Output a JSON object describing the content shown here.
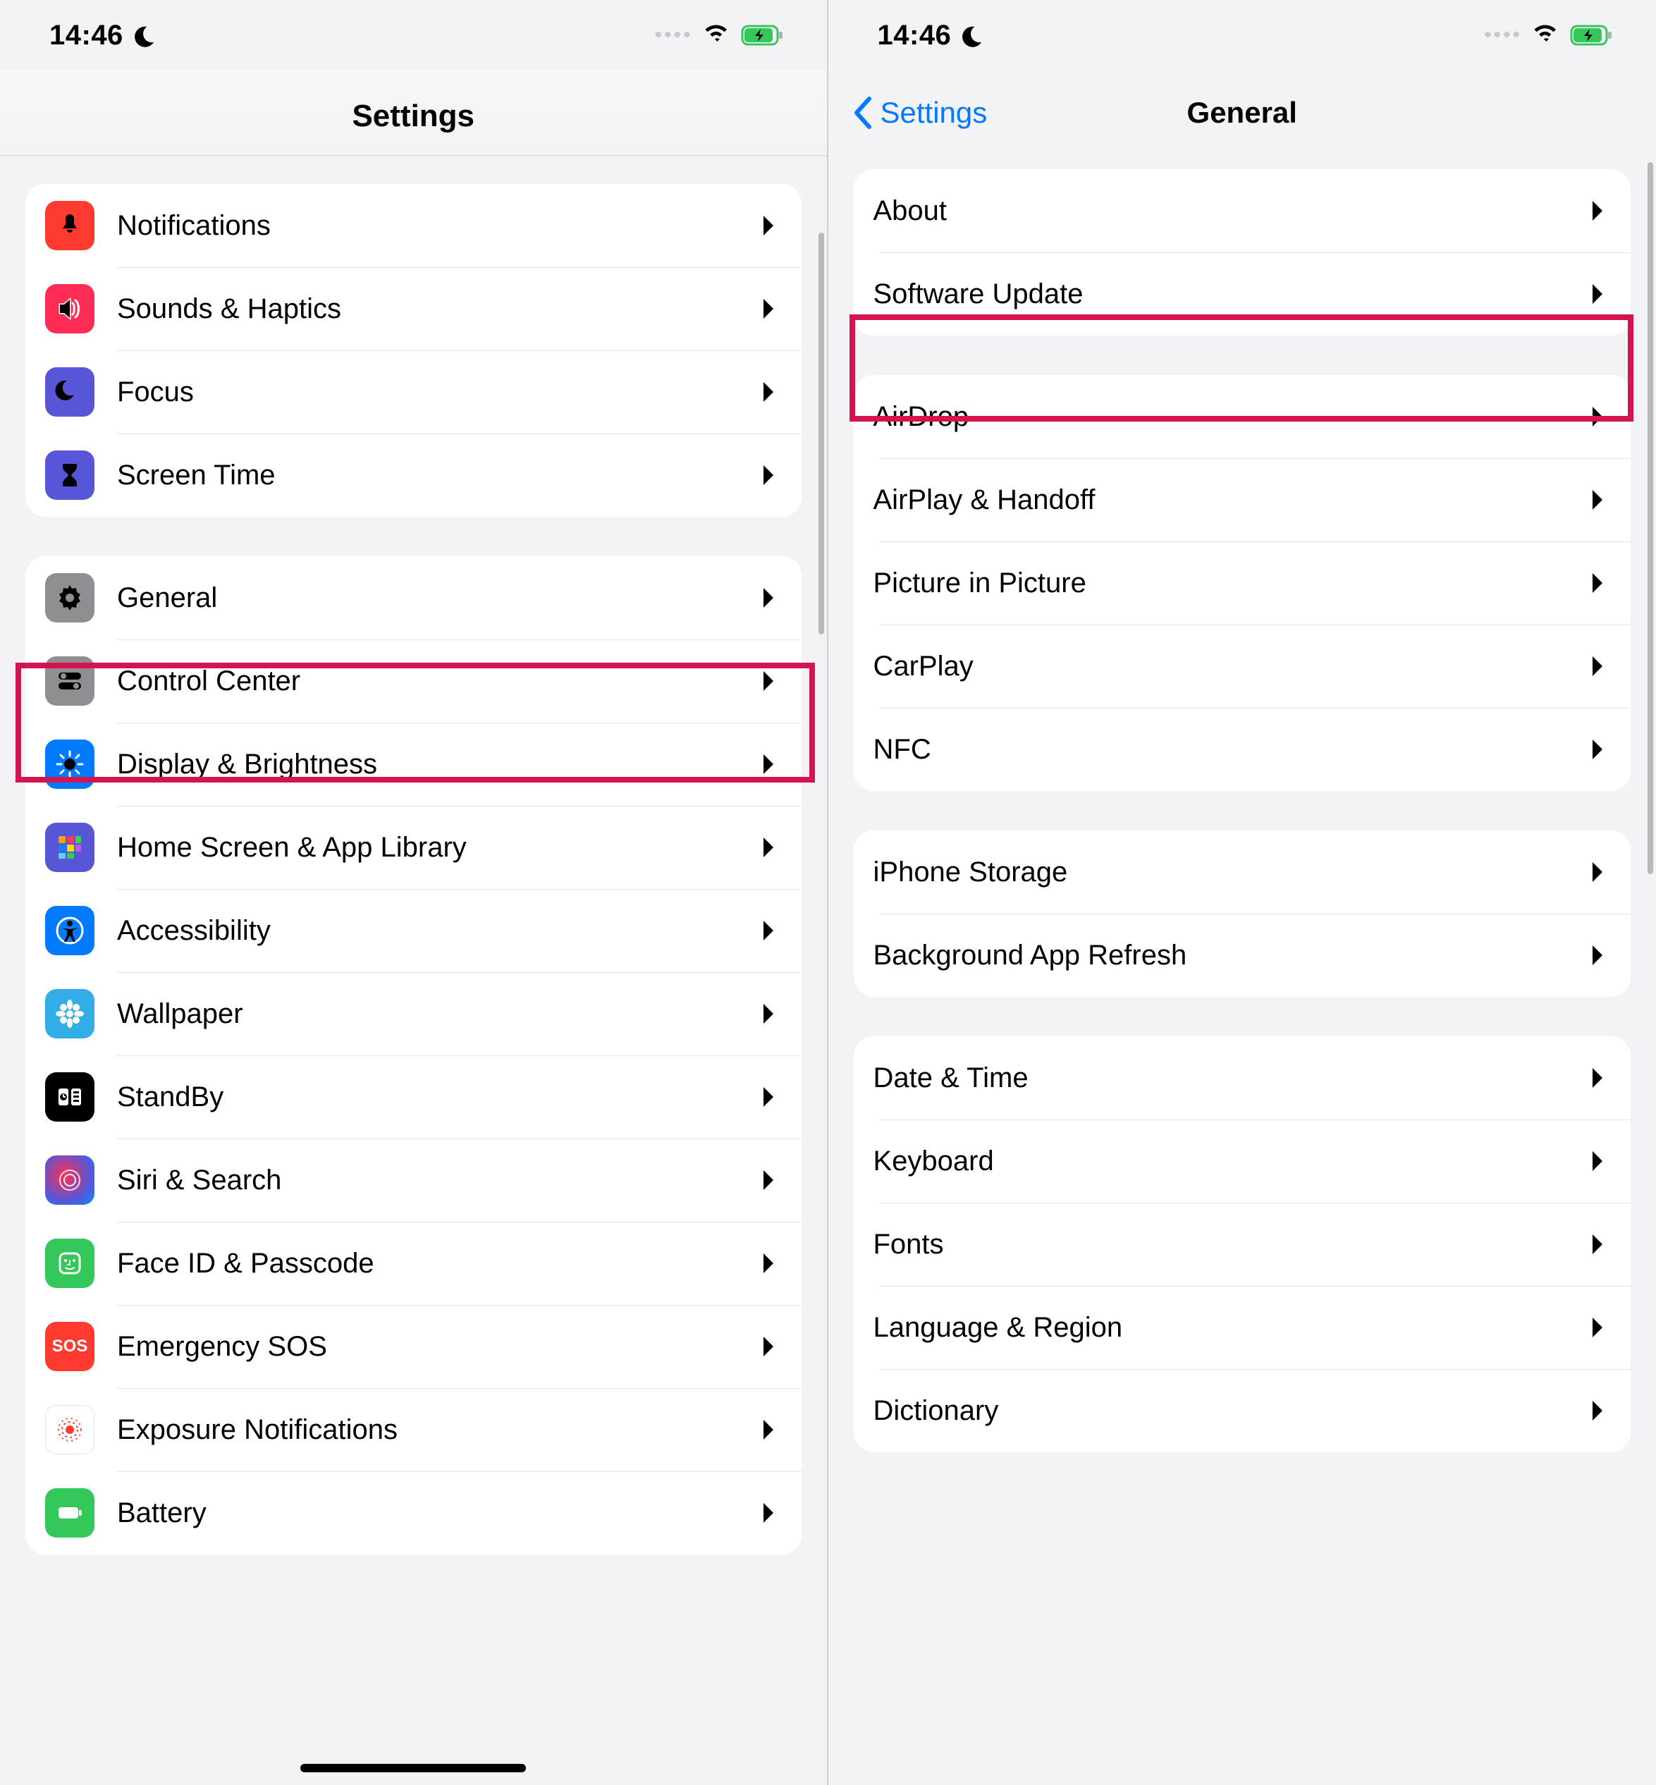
{
  "status": {
    "time": "14:46"
  },
  "left": {
    "title": "Settings",
    "group1": [
      {
        "label": "Notifications",
        "icon": "bell",
        "color": "i-red"
      },
      {
        "label": "Sounds & Haptics",
        "icon": "speaker",
        "color": "i-pink"
      },
      {
        "label": "Focus",
        "icon": "moon",
        "color": "i-purple"
      },
      {
        "label": "Screen Time",
        "icon": "hourglass",
        "color": "i-purple"
      }
    ],
    "group2": [
      {
        "label": "General",
        "icon": "gear",
        "color": "i-gray"
      },
      {
        "label": "Control Center",
        "icon": "toggles",
        "color": "i-gray"
      },
      {
        "label": "Display & Brightness",
        "icon": "sun",
        "color": "i-blue"
      },
      {
        "label": "Home Screen & App Library",
        "icon": "apps",
        "color": "i-apps"
      },
      {
        "label": "Accessibility",
        "icon": "accessibility",
        "color": "i-blue"
      },
      {
        "label": "Wallpaper",
        "icon": "flower",
        "color": "i-cyan"
      },
      {
        "label": "StandBy",
        "icon": "standby",
        "color": "i-black"
      },
      {
        "label": "Siri & Search",
        "icon": "siri",
        "color": "i-siri"
      },
      {
        "label": "Face ID & Passcode",
        "icon": "faceid",
        "color": "i-green"
      },
      {
        "label": "Emergency SOS",
        "icon": "sos",
        "color": "i-sos"
      },
      {
        "label": "Exposure Notifications",
        "icon": "exposure",
        "color": "i-white"
      },
      {
        "label": "Battery",
        "icon": "battery",
        "color": "i-green"
      }
    ]
  },
  "right": {
    "back": "Settings",
    "title": "General",
    "group1": [
      {
        "label": "About"
      },
      {
        "label": "Software Update"
      }
    ],
    "group2": [
      {
        "label": "AirDrop"
      },
      {
        "label": "AirPlay & Handoff"
      },
      {
        "label": "Picture in Picture"
      },
      {
        "label": "CarPlay"
      },
      {
        "label": "NFC"
      }
    ],
    "group3": [
      {
        "label": "iPhone Storage"
      },
      {
        "label": "Background App Refresh"
      }
    ],
    "group4": [
      {
        "label": "Date & Time"
      },
      {
        "label": "Keyboard"
      },
      {
        "label": "Fonts"
      },
      {
        "label": "Language & Region"
      },
      {
        "label": "Dictionary"
      }
    ]
  },
  "highlights": {
    "left_general": true,
    "right_software_update": true
  }
}
